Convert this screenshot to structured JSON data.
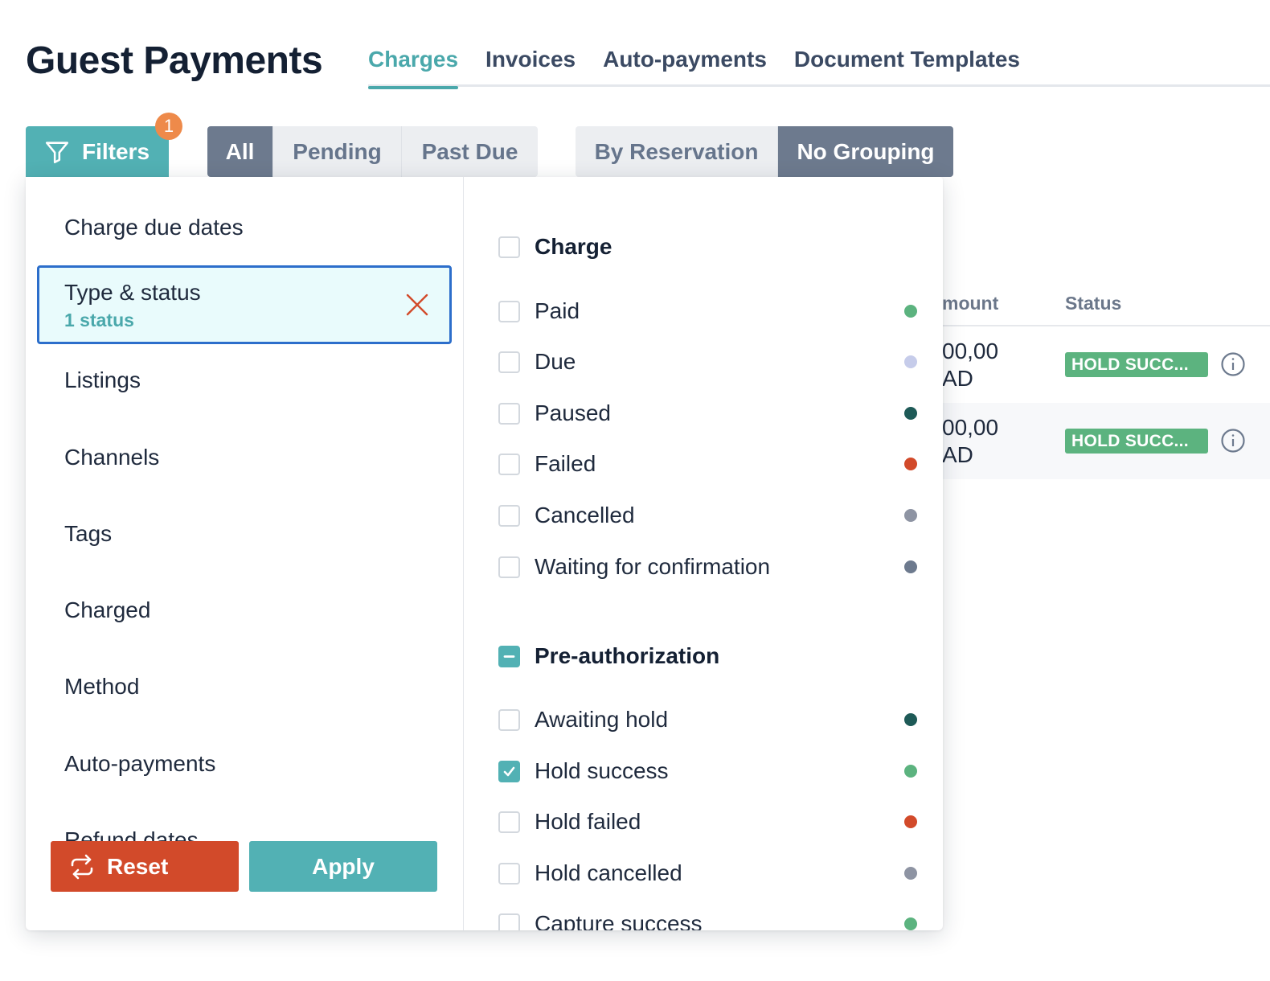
{
  "page": {
    "title": "Guest Payments"
  },
  "tabs": [
    "Charges",
    "Invoices",
    "Auto-payments",
    "Document Templates"
  ],
  "toolbar": {
    "filters_label": "Filters",
    "filters_badge": "1",
    "status_segments": [
      "All",
      "Pending",
      "Past Due"
    ],
    "grouping_segments": [
      "By Reservation",
      "No Grouping"
    ]
  },
  "table": {
    "columns": [
      "mount",
      "Status"
    ],
    "rows": [
      {
        "amount_line1": "00,00",
        "amount_line2": "AD",
        "status": "HOLD SUCC..."
      },
      {
        "amount_line1": "00,00",
        "amount_line2": "AD",
        "status": "HOLD SUCC..."
      }
    ]
  },
  "filter_panel": {
    "categories": {
      "charge_due_dates": "Charge due dates",
      "type_status": "Type & status",
      "type_status_sub": "1 status",
      "listings": "Listings",
      "channels": "Channels",
      "tags": "Tags",
      "charged": "Charged",
      "method": "Method",
      "auto_payments": "Auto-payments",
      "refund_dates": "Refund dates"
    },
    "reset_label": "Reset",
    "apply_label": "Apply",
    "groups": {
      "charge": {
        "label": "Charge",
        "items": [
          "Paid",
          "Due",
          "Paused",
          "Failed",
          "Cancelled",
          "Waiting for confirmation"
        ]
      },
      "preauth": {
        "label": "Pre-authorization",
        "items": [
          "Awaiting hold",
          "Hold success",
          "Hold failed",
          "Hold cancelled",
          "Capture success"
        ]
      }
    }
  },
  "colors": {
    "accent": "#52b1b4",
    "reset": "#d24a2a",
    "status_green": "#5cb37f",
    "dot_green": "#5cb37f",
    "dot_lavender": "#c6ccea",
    "dot_teal_dark": "#1e5a57",
    "dot_red": "#d24a2a",
    "dot_gray": "#8e94a3",
    "dot_slate": "#6d7a8e"
  },
  "icons": [
    "filter-icon",
    "close-icon",
    "reset-icon",
    "info-icon",
    "check-icon",
    "minus-icon"
  ]
}
